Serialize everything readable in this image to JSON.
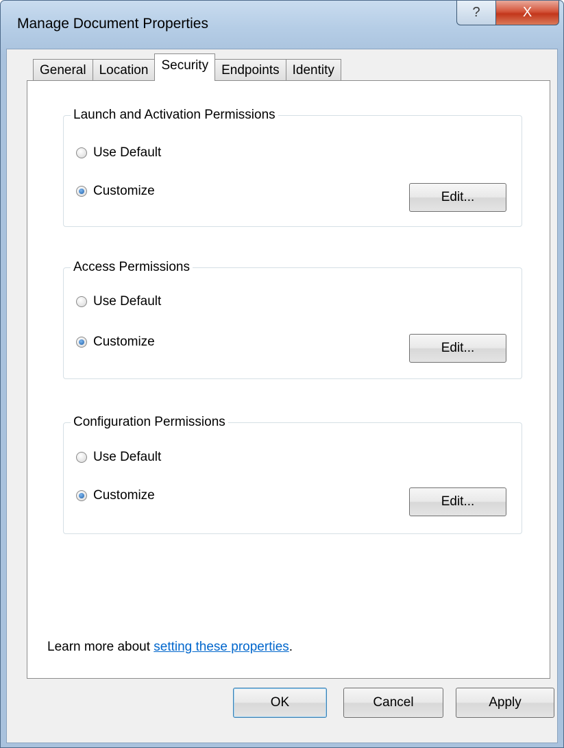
{
  "window": {
    "title": "Manage Document Properties",
    "help_glyph": "?",
    "close_glyph": "X"
  },
  "tabs": [
    {
      "label": "General",
      "selected": false
    },
    {
      "label": "Location",
      "selected": false
    },
    {
      "label": "Security",
      "selected": true
    },
    {
      "label": "Endpoints",
      "selected": false
    },
    {
      "label": "Identity",
      "selected": false
    }
  ],
  "groups": [
    {
      "legend": "Launch and Activation Permissions",
      "use_default_label": "Use Default",
      "customize_label": "Customize",
      "selected": "customize",
      "edit_label": "Edit..."
    },
    {
      "legend": "Access Permissions",
      "use_default_label": "Use Default",
      "customize_label": "Customize",
      "selected": "customize",
      "edit_label": "Edit..."
    },
    {
      "legend": "Configuration Permissions",
      "use_default_label": "Use Default",
      "customize_label": "Customize",
      "selected": "customize",
      "edit_label": "Edit..."
    }
  ],
  "learn_more": {
    "prefix": "Learn more about ",
    "link_text": "setting these properties",
    "suffix": "."
  },
  "footer": {
    "ok_label": "OK",
    "cancel_label": "Cancel",
    "apply_label": "Apply"
  }
}
